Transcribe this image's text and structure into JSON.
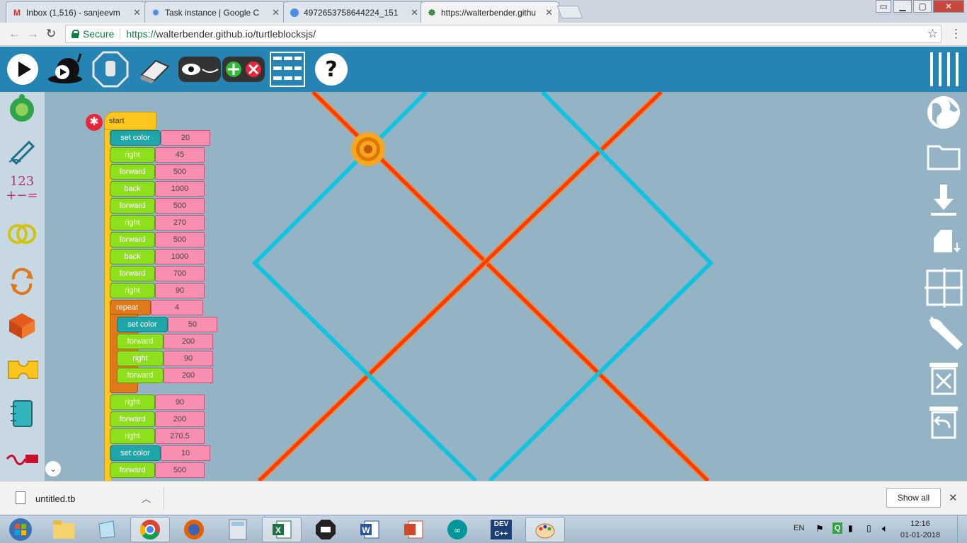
{
  "browser": {
    "tabs": [
      {
        "label": "Inbox (1,516) - sanjeevm",
        "icon": "gmail-icon"
      },
      {
        "label": "Task instance | Google C",
        "icon": "gear-icon"
      },
      {
        "label": "4972653758644224_151",
        "icon": "doc-icon"
      },
      {
        "label": "https://walterbender.githu",
        "icon": "turtle-icon"
      }
    ],
    "secure_label": "Secure",
    "url_scheme": "https://",
    "url_rest": "walterbender.github.io/turtleblocksjs/"
  },
  "blocks": {
    "start_label": "start",
    "items": [
      {
        "label": "set color",
        "value": "20",
        "color": "teal"
      },
      {
        "label": "right",
        "value": "45",
        "color": "green"
      },
      {
        "label": "forward",
        "value": "500",
        "color": "green"
      },
      {
        "label": "back",
        "value": "1000",
        "color": "green"
      },
      {
        "label": "forward",
        "value": "500",
        "color": "green"
      },
      {
        "label": "right",
        "value": "270",
        "color": "green"
      },
      {
        "label": "forward",
        "value": "500",
        "color": "green"
      },
      {
        "label": "back",
        "value": "1000",
        "color": "green"
      },
      {
        "label": "forward",
        "value": "700",
        "color": "green"
      },
      {
        "label": "right",
        "value": "90",
        "color": "green"
      }
    ],
    "repeat": {
      "label": "repeat",
      "value": "4",
      "inner": [
        {
          "label": "set color",
          "value": "50",
          "color": "teal"
        },
        {
          "label": "forward",
          "value": "200",
          "color": "green"
        },
        {
          "label": "right",
          "value": "90",
          "color": "green"
        },
        {
          "label": "forward",
          "value": "200",
          "color": "green"
        }
      ]
    },
    "after": [
      {
        "label": "right",
        "value": "90",
        "color": "green"
      },
      {
        "label": "forward",
        "value": "200",
        "color": "green"
      },
      {
        "label": "right",
        "value": "270.5",
        "color": "green"
      },
      {
        "label": "set color",
        "value": "10",
        "color": "teal"
      },
      {
        "label": "forward",
        "value": "500",
        "color": "green"
      }
    ]
  },
  "palette_icons": [
    "turtle-palette",
    "pen-palette",
    "number-palette",
    "boolean-palette",
    "flow-palette",
    "action-palette",
    "box-palette",
    "media-palette",
    "sensor-palette"
  ],
  "palette_number_text": "123",
  "download": {
    "file": "untitled.tb",
    "show_all": "Show all"
  },
  "taskbar": {
    "lang": "EN",
    "time": "12:16",
    "date": "01-01-2018",
    "dev_label": "DEV"
  },
  "colors": {
    "toolbar": "#2584b4",
    "canvas": "#94b4c6",
    "line_red": "#ff3a0a",
    "line_cyan": "#12c2df"
  }
}
